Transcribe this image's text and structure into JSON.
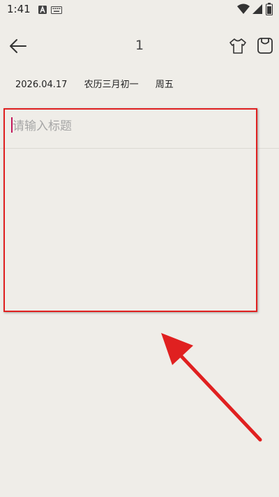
{
  "status_bar": {
    "time": "1:41",
    "icons": [
      "a-notification-icon",
      "keyboard-icon",
      "wifi-icon",
      "signal-icon",
      "battery-icon"
    ]
  },
  "toolbar": {
    "title": "1",
    "back_icon": "arrow-left-icon",
    "theme_icon": "tshirt-icon",
    "save_icon": "save-bag-icon"
  },
  "date_row": {
    "date": "2026.04.17",
    "lunar": "农历三月初一",
    "weekday": "周五"
  },
  "editor": {
    "title_placeholder": "请输入标题",
    "title_value": ""
  },
  "annotation": {
    "color": "#e02020"
  },
  "colors": {
    "background": "#efede8",
    "cursor": "#c2185b",
    "placeholder": "#a6a6a6"
  }
}
